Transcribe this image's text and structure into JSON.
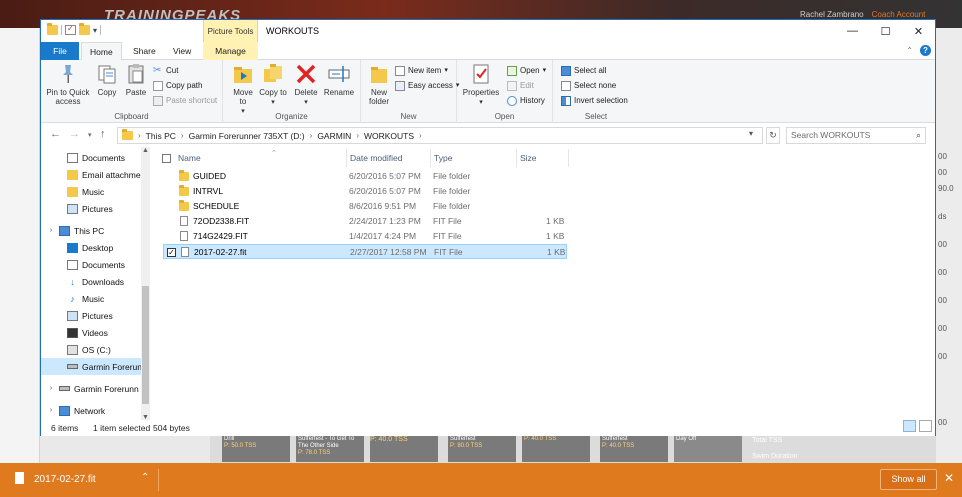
{
  "background_app": {
    "logo": "TRAININGPEAKS",
    "user_name": "Rachel Zambrano",
    "user_link": "Coach Account",
    "right_values": [
      "00",
      "00",
      "90.0",
      "ds",
      "00",
      "00",
      "00",
      "00",
      "00",
      "00"
    ],
    "calendar_cells": [
      {
        "title": "Drill",
        "sub": "P: 50.0 TSS"
      },
      {
        "title": "Sufferfest - To Get To The Other Side",
        "sub": "P: 78.0 TSS"
      },
      {
        "title": "Sufferfest",
        "sub": "P: 80.0 TSS"
      },
      {
        "title": "Sufferfest",
        "sub": "P: 40.0 TSS"
      }
    ],
    "calendar_labels": [
      "P: 40.0 TSS",
      "P: 40.0 TSS",
      "Day Off"
    ],
    "summary_labels": [
      "Total TSS",
      "Swim Duration"
    ]
  },
  "window": {
    "title": "WORKOUTS",
    "contextual_tab": "Picture Tools",
    "minimize": "—",
    "maximize": "☐",
    "close": "✕",
    "tabs": [
      "File",
      "Home",
      "Share",
      "View",
      "Manage"
    ],
    "active_tab": "Home"
  },
  "ribbon": {
    "clipboard": {
      "label": "Clipboard",
      "pin": "Pin to Quick access",
      "copy": "Copy",
      "paste": "Paste",
      "cut": "Cut",
      "copy_path": "Copy path",
      "paste_shortcut": "Paste shortcut"
    },
    "organize": {
      "label": "Organize",
      "move_to": "Move to",
      "copy_to": "Copy to",
      "delete": "Delete",
      "rename": "Rename"
    },
    "new": {
      "label": "New",
      "new_folder": "New folder",
      "new_item": "New item",
      "easy_access": "Easy access"
    },
    "open": {
      "label": "Open",
      "properties": "Properties",
      "open": "Open",
      "edit": "Edit",
      "history": "History"
    },
    "select": {
      "label": "Select",
      "select_all": "Select all",
      "select_none": "Select none",
      "invert": "Invert selection"
    }
  },
  "address": {
    "crumbs": [
      "This PC",
      "Garmin Forerunner 735XT (D:)",
      "GARMIN",
      "WORKOUTS"
    ],
    "search_placeholder": "Search WORKOUTS"
  },
  "nav_pane": {
    "items": [
      {
        "label": "Documents",
        "icon": "documents-icon",
        "indent": 2
      },
      {
        "label": "Email attachmen",
        "icon": "folder-icon",
        "indent": 2
      },
      {
        "label": "Music",
        "icon": "folder-icon",
        "indent": 2
      },
      {
        "label": "Pictures",
        "icon": "pictures-icon",
        "indent": 2
      },
      {
        "label": "This PC",
        "icon": "pc-icon",
        "indent": 1
      },
      {
        "label": "Desktop",
        "icon": "desktop-icon",
        "indent": 2
      },
      {
        "label": "Documents",
        "icon": "documents-icon",
        "indent": 2
      },
      {
        "label": "Downloads",
        "icon": "downloads-icon",
        "indent": 2
      },
      {
        "label": "Music",
        "icon": "music-icon",
        "indent": 2
      },
      {
        "label": "Pictures",
        "icon": "pictures-icon",
        "indent": 2
      },
      {
        "label": "Videos",
        "icon": "videos-icon",
        "indent": 2
      },
      {
        "label": "OS (C:)",
        "icon": "drive-icon",
        "indent": 2
      },
      {
        "label": "Garmin Forerunn",
        "icon": "usb-drive-icon",
        "indent": 2,
        "selected": true
      },
      {
        "label": "Garmin Forerunn",
        "icon": "usb-drive-icon",
        "indent": 1
      },
      {
        "label": "Network",
        "icon": "network-icon",
        "indent": 1
      }
    ]
  },
  "file_list": {
    "columns": {
      "name": "Name",
      "date": "Date modified",
      "type": "Type",
      "size": "Size"
    },
    "rows": [
      {
        "name": "GUIDED",
        "date": "6/20/2016 5:07 PM",
        "type": "File folder",
        "size": "",
        "kind": "folder"
      },
      {
        "name": "INTRVL",
        "date": "6/20/2016 5:07 PM",
        "type": "File folder",
        "size": "",
        "kind": "folder"
      },
      {
        "name": "SCHEDULE",
        "date": "8/6/2016 9:51 PM",
        "type": "File folder",
        "size": "",
        "kind": "folder"
      },
      {
        "name": "72OD2338.FIT",
        "date": "2/24/2017 1:23 PM",
        "type": "FIT File",
        "size": "1 KB",
        "kind": "file"
      },
      {
        "name": "714G2429.FIT",
        "date": "1/4/2017 4:24 PM",
        "type": "FIT File",
        "size": "1 KB",
        "kind": "file"
      },
      {
        "name": "2017-02-27.fit",
        "date": "2/27/2017 12:58 PM",
        "type": "FIT File",
        "size": "1 KB",
        "kind": "file",
        "selected": true
      }
    ]
  },
  "status": {
    "count": "6 items",
    "selected": "1 item selected",
    "size": "504 bytes"
  },
  "download_bar": {
    "file_name": "2017-02-27.fit",
    "show_all": "Show all"
  },
  "colors": {
    "accent": "#1979ca",
    "selection": "#cce8ff",
    "download_bar": "#e07a1f",
    "folder": "#f3c84b"
  }
}
